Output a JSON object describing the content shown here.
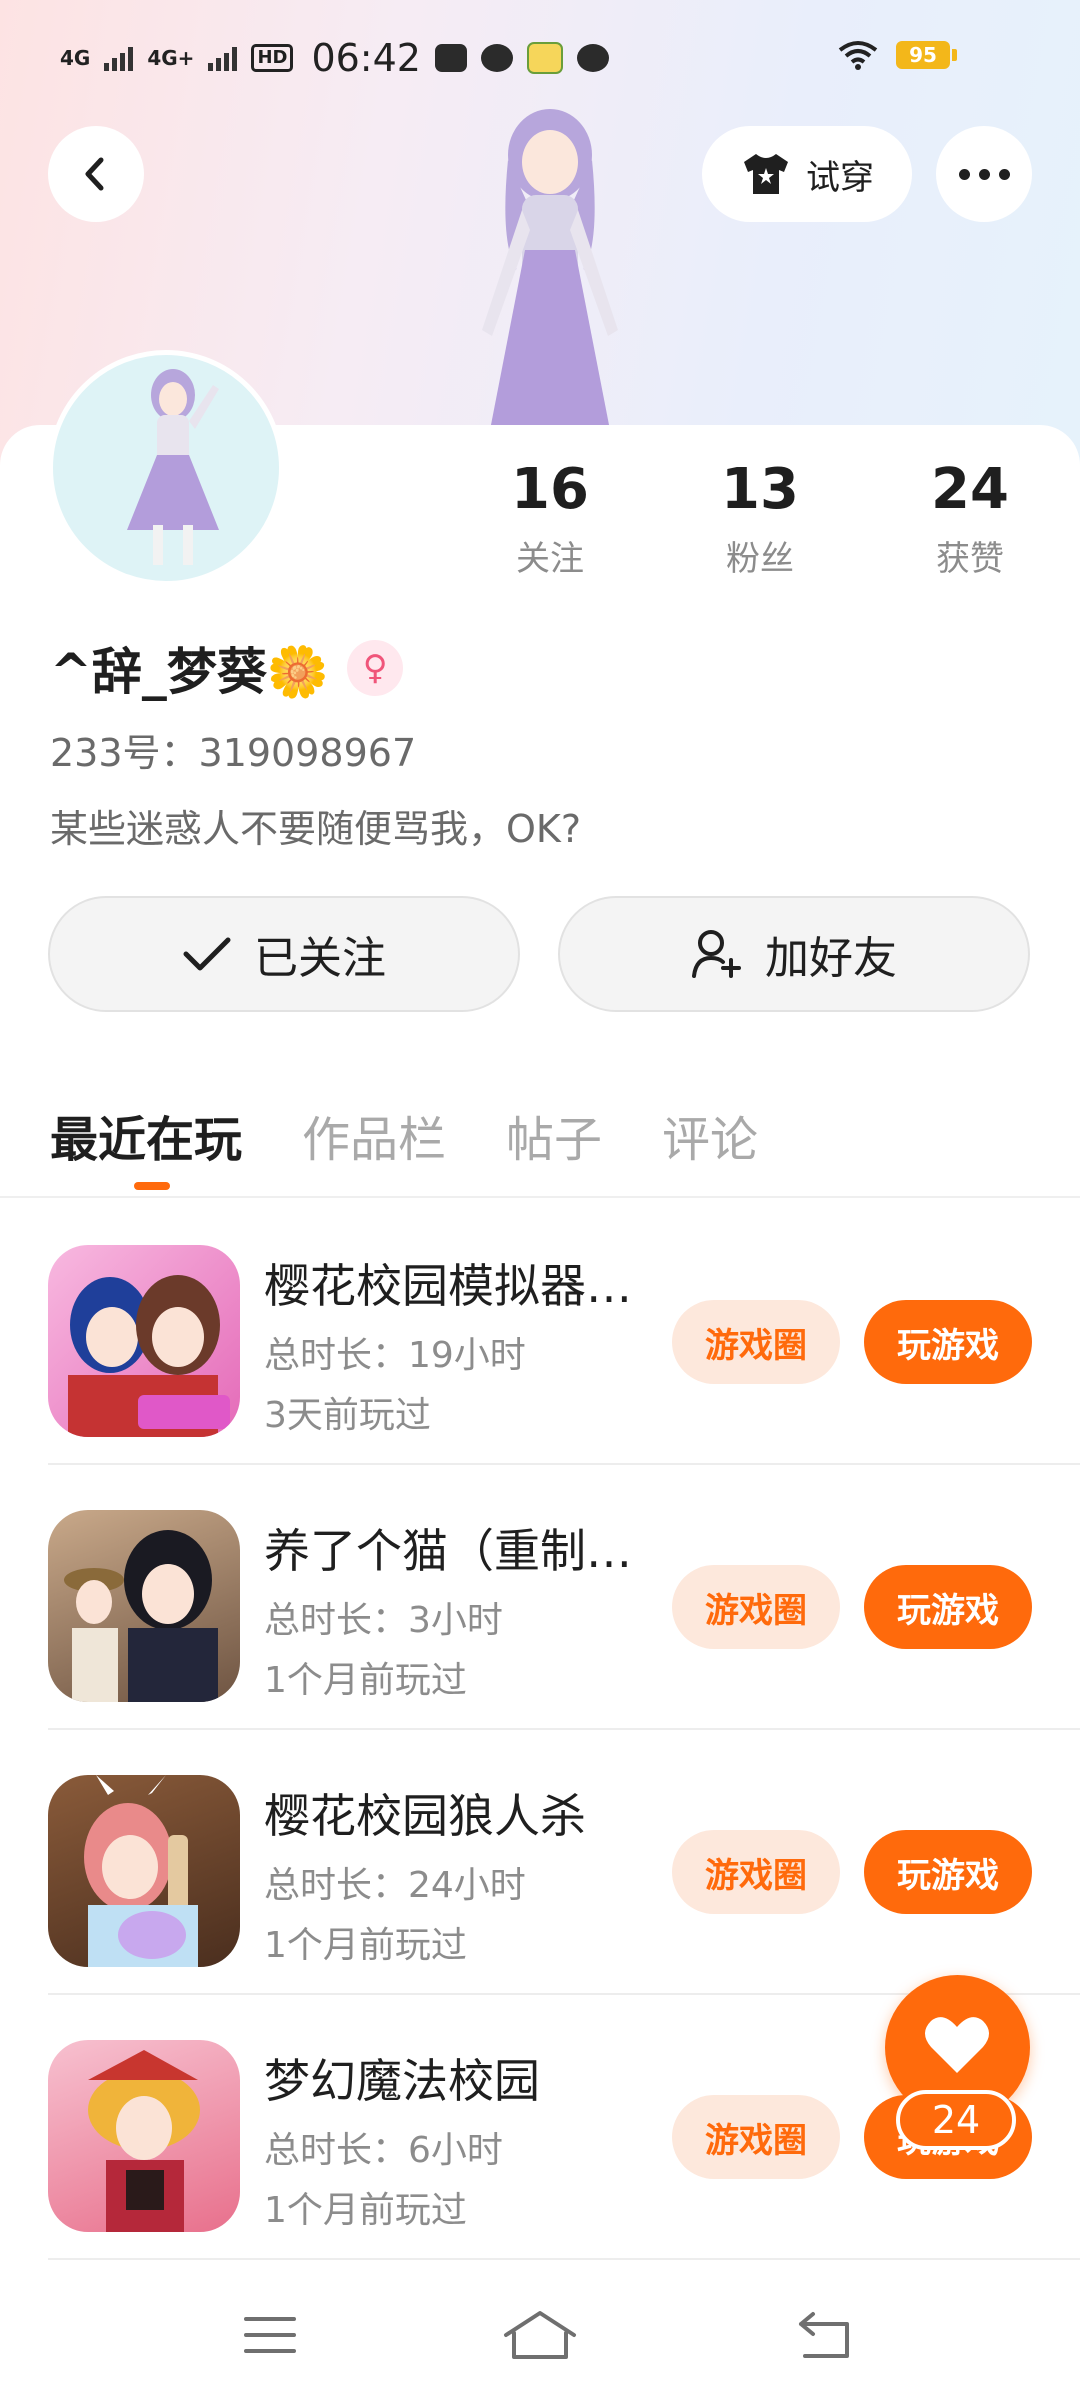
{
  "status_bar": {
    "network_1": "4G",
    "network_2": "4G+",
    "hd_badge": "HD",
    "time": "06:42",
    "battery": "95",
    "icons": [
      "wechat-icon",
      "cloud-icon",
      "app-100-icon",
      "loop-icon",
      "wifi-icon"
    ]
  },
  "header": {
    "back_icon": "chevron-left-icon",
    "try_on_label": "试穿",
    "try_on_icon": "tshirt-icon",
    "more_icon": "more-dots-icon"
  },
  "profile": {
    "stats": [
      {
        "value": "16",
        "label": "关注"
      },
      {
        "value": "13",
        "label": "粉丝"
      },
      {
        "value": "24",
        "label": "获赞"
      }
    ],
    "name": "^辞_梦葵🌼",
    "gender_icon": "female-icon",
    "uid": "233号：319098967",
    "bio": "某些迷惑人不要随便骂我，OK?"
  },
  "actions": {
    "following_label": "已关注",
    "add_friend_label": "加好友"
  },
  "tabs": [
    "最近在玩",
    "作品栏",
    "帖子",
    "评论"
  ],
  "games": [
    {
      "title": "樱花校园模拟器…",
      "duration": "总时长：19小时",
      "last_played": "3天前玩过",
      "circle_label": "游戏圈",
      "play_label": "玩游戏"
    },
    {
      "title": "养了个猫（重制…",
      "duration": "总时长：3小时",
      "last_played": "1个月前玩过",
      "circle_label": "游戏圈",
      "play_label": "玩游戏"
    },
    {
      "title": "樱花校园狼人杀",
      "duration": "总时长：24小时",
      "last_played": "1个月前玩过",
      "circle_label": "游戏圈",
      "play_label": "玩游戏"
    },
    {
      "title": "梦幻魔法校园",
      "duration": "总时长：6小时",
      "last_played": "1个月前玩过",
      "circle_label": "游戏圈",
      "play_label": "玩游戏"
    }
  ],
  "fab": {
    "icon": "heart-icon",
    "count": "24"
  },
  "nav": {
    "icons": [
      "menu-icon",
      "home-icon",
      "back-icon"
    ]
  },
  "colors": {
    "accent": "#ff6a0c",
    "accent_light": "#fde8dc"
  }
}
